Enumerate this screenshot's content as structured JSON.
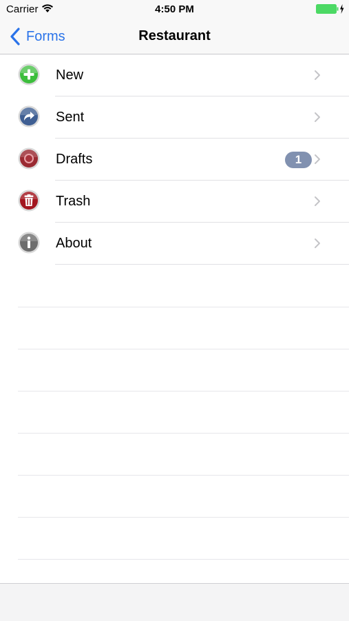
{
  "status_bar": {
    "carrier": "Carrier",
    "time": "4:50 PM",
    "wifi_icon": "wifi-icon",
    "battery_icon": "battery-charging-icon",
    "battery_color": "#4cd964"
  },
  "nav": {
    "back_label": "Forms",
    "back_icon": "chevron-left-icon",
    "title": "Restaurant",
    "accent_color": "#2a73e9"
  },
  "menu": {
    "items": [
      {
        "label": "New",
        "icon": "add-icon",
        "icon_color": "#3cbe3c"
      },
      {
        "label": "Sent",
        "icon": "sent-arrow-icon",
        "icon_color": "#3f5f93"
      },
      {
        "label": "Drafts",
        "icon": "drafts-record-icon",
        "icon_color": "#9a2a32",
        "badge": "1"
      },
      {
        "label": "Trash",
        "icon": "trash-icon",
        "icon_color": "#a3161f"
      },
      {
        "label": "About",
        "icon": "info-icon",
        "icon_color": "#6d6d6d"
      }
    ],
    "badge_color": "#8191b0"
  }
}
